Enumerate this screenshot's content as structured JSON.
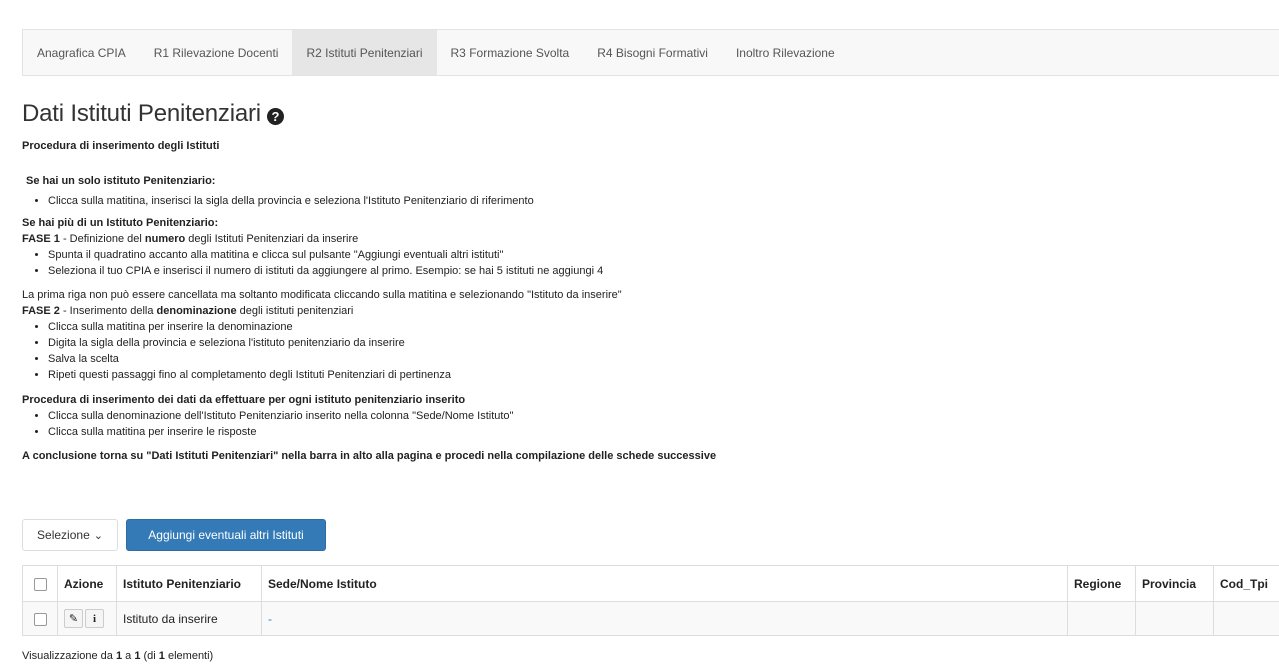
{
  "tabs": [
    {
      "label": "Anagrafica CPIA",
      "active": false
    },
    {
      "label": "R1 Rilevazione Docenti",
      "active": false
    },
    {
      "label": "R2 Istituti Penitenziari",
      "active": true
    },
    {
      "label": "R3 Formazione Svolta",
      "active": false
    },
    {
      "label": "R4 Bisogni Formativi",
      "active": false
    },
    {
      "label": "Inoltro Rilevazione",
      "active": false
    }
  ],
  "page": {
    "title": "Dati Istituti Penitenziari",
    "help_icon": "question-circle-icon",
    "help_glyph": "?"
  },
  "instructions": {
    "heading": "Procedura di inserimento degli Istituti",
    "single_heading": "Se hai un solo istituto Penitenziario:",
    "single_items": [
      "Clicca sulla matitina, inserisci la sigla della provincia e seleziona l'Istituto Penitenziario di riferimento"
    ],
    "multi_heading": "Se hai più di un Istituto Penitenziario:",
    "fase1_prefix": "FASE  1",
    "fase1_text_a": " - Definizione del ",
    "fase1_bold": "numero",
    "fase1_text_b": " degli Istituti Penitenziari da inserire",
    "fase1_items": [
      "Spunta il quadratino accanto alla matitina e clicca sul pulsante \"Aggiungi eventuali  altri istituti\"",
      "Seleziona il tuo CPIA e inserisci il numero di istituti da aggiungere al primo. Esempio: se hai 5 istituti ne aggiungi 4"
    ],
    "note": "La prima riga non può essere cancellata ma soltanto modificata cliccando sulla matitina e selezionando \"Istituto da inserire\"",
    "fase2_prefix": "FASE 2",
    "fase2_text_a": " - Inserimento della ",
    "fase2_bold": "denominazione",
    "fase2_text_b": " degli istituti penitenziari",
    "fase2_items": [
      "Clicca sulla matitina per inserire la denominazione",
      "Digita la sigla della provincia e seleziona l'istituto penitenziario da inserire",
      "Salva la scelta",
      "Ripeti questi passaggi fino al completamento degli Istituti Penitenziari  di pertinenza"
    ],
    "data_heading": "Procedura di inserimento dei dati  da effettuare  per ogni istituto penitenziario inserito",
    "data_items": [
      "Clicca sulla denominazione dell'Istituto Penitenziario inserito nella colonna \"Sede/Nome Istituto\"",
      "Clicca sulla matitina per inserire le risposte"
    ],
    "conclusion": "A conclusione torna su \"Dati Istituti Penitenziari\" nella barra in alto alla pagina e procedi nella compilazione delle schede successive"
  },
  "toolbar": {
    "select_label": "Selezione",
    "select_chevron": "⌄",
    "add_label": "Aggiungi eventuali altri Istituti"
  },
  "table": {
    "headers": [
      "Azione",
      "Istituto Penitenziario",
      "Sede/Nome Istituto",
      "Regione",
      "Provincia",
      "Cod_Tpi"
    ],
    "rows": [
      {
        "istituto": "Istituto da inserire",
        "sede": "-",
        "regione": "",
        "provincia": "",
        "cod_tpi": "",
        "edit_icon": "pencil-square-icon",
        "edit_glyph": "✎",
        "info_icon": "info-icon",
        "info_glyph": "i"
      }
    ]
  },
  "footer": {
    "prefix": "Visualizzazione da ",
    "from": "1",
    "middle": " a ",
    "to": "1",
    "paren_open": " (di ",
    "total": "1",
    "suffix": " elementi)"
  }
}
